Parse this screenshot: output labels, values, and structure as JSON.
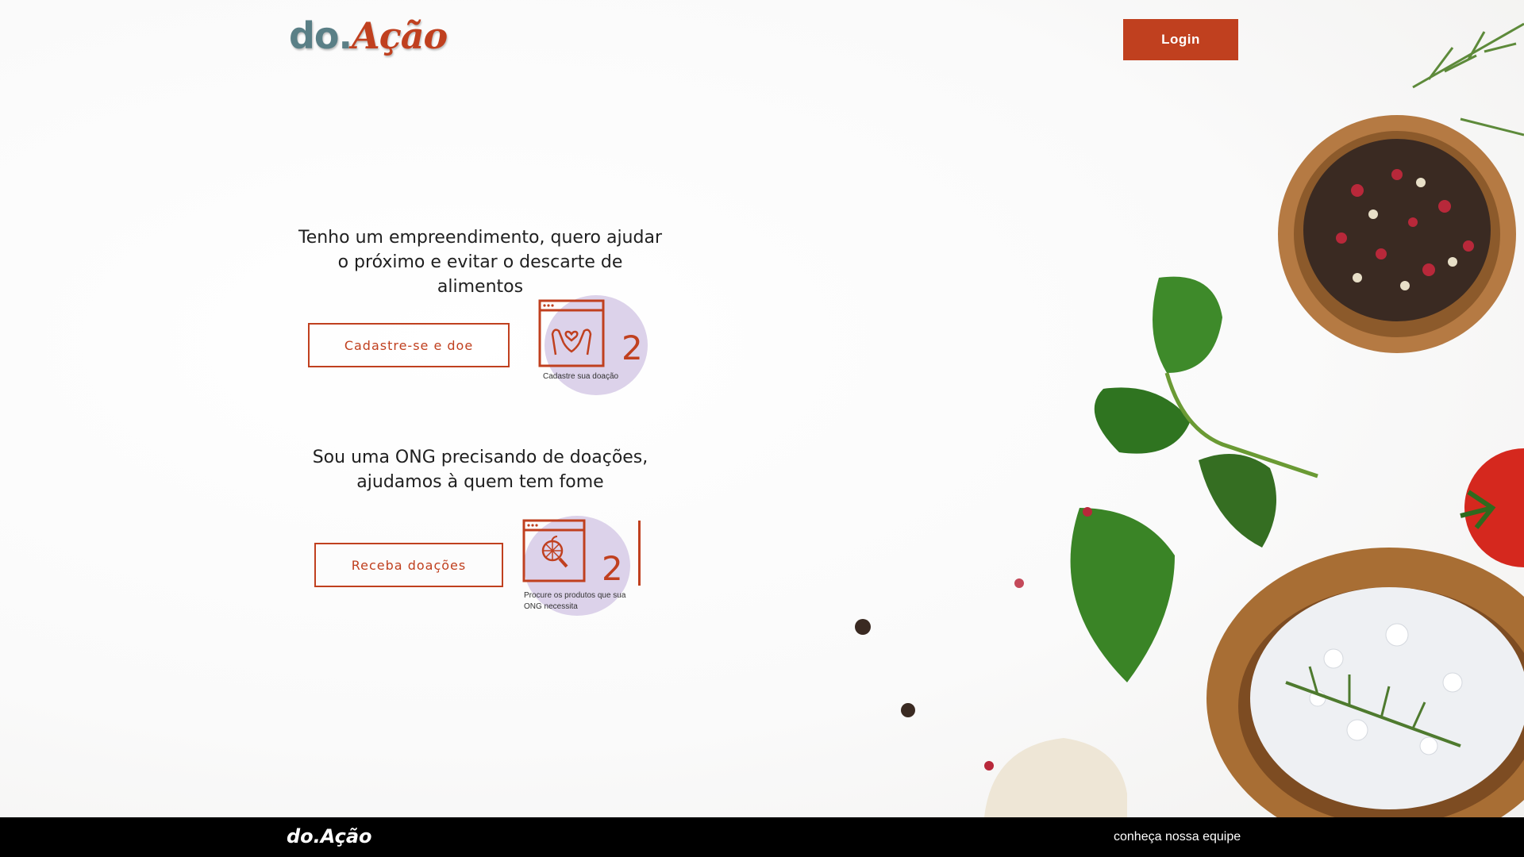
{
  "header": {
    "logo_part1": "do.",
    "logo_part2": "Ação",
    "login_label": "Login"
  },
  "donor": {
    "text": "Tenho um empreendimento, quero ajudar o próximo e evitar o descarte de alimentos",
    "button_label": "Cadastre-se e doe",
    "step_number": "2",
    "step_caption": "Cadastre sua doação"
  },
  "ong": {
    "text": "Sou uma ONG precisando de doações, ajudamos à quem tem fome",
    "button_label": "Receba doações",
    "step_number": "2",
    "step_caption": "Procure os produtos que sua ONG necessita"
  },
  "footer": {
    "logo": "do.Ação",
    "team_link": "conheça nossa equipe"
  },
  "colors": {
    "accent": "#c0401f",
    "logo_blue": "#5a7f86",
    "blob": "#dcd2ea",
    "footer_bg": "#000000"
  },
  "icons": [
    "hands-heart-window-icon",
    "orange-search-window-icon"
  ]
}
